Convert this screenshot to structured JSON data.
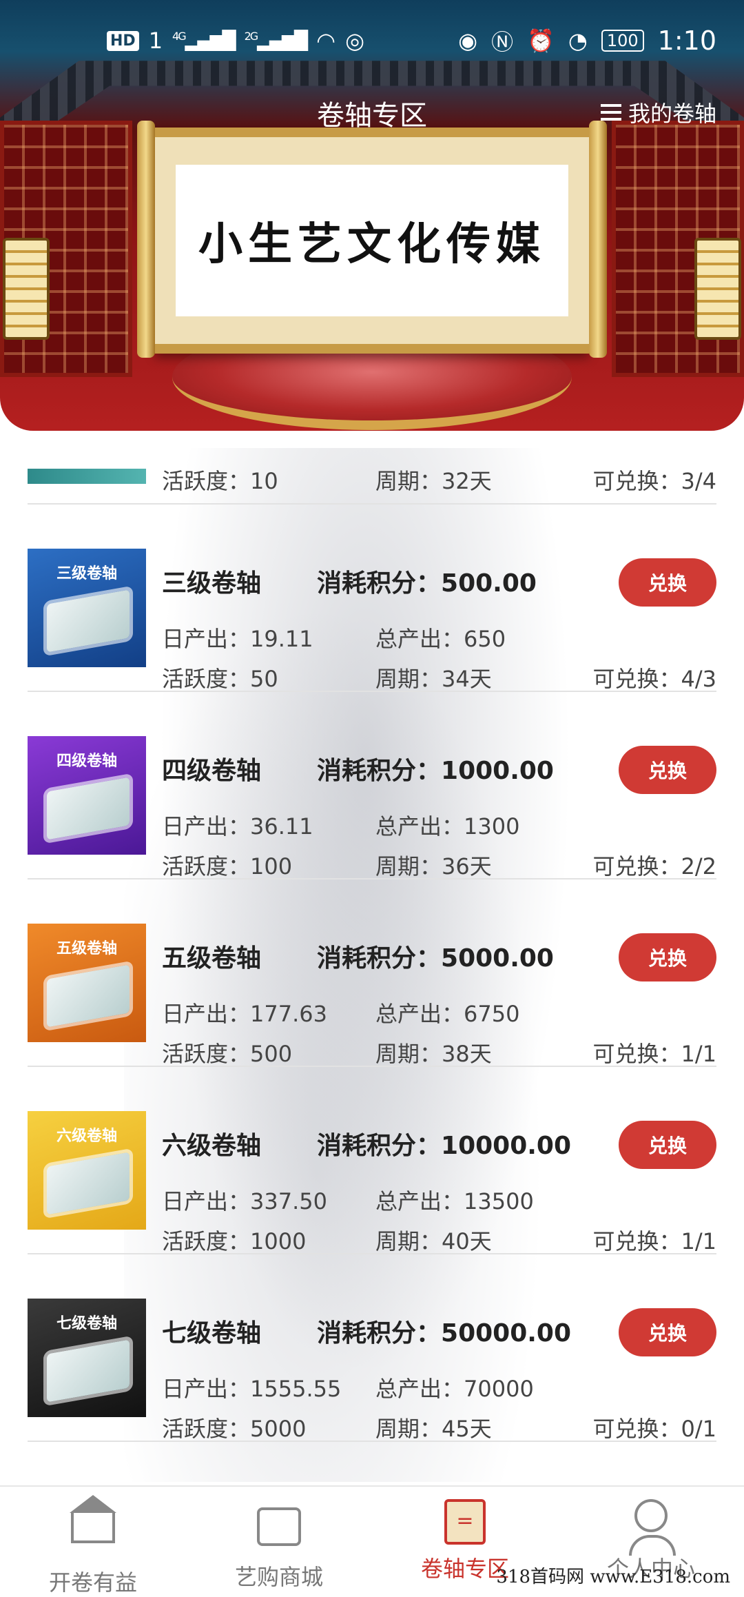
{
  "status_bar": {
    "hd_label": "HD",
    "sim_label": "1",
    "net1": "4G",
    "net2": "2G",
    "battery": "100",
    "time": "1:10"
  },
  "header": {
    "title": "卷轴专区",
    "my_scrolls_label": "我的卷轴",
    "banner_text": "小生艺文化传媒"
  },
  "labels": {
    "cost": "消耗积分：",
    "daily_output": "日产出：",
    "total_output": "总产出：",
    "activity": "活跃度：",
    "period": "周期：",
    "exchangeable": "可兑换：",
    "button": "兑换"
  },
  "partial_item": {
    "activity": "10",
    "period": "32天",
    "exchangeable": "3/4"
  },
  "items": [
    {
      "badge": "三级卷轴",
      "name": "三级卷轴",
      "cost": "500.00",
      "daily": "19.11",
      "total": "650",
      "activity": "50",
      "period": "34天",
      "exchangeable": "4/3",
      "color_top": "#2d6fc4",
      "color_bottom": "#123f86"
    },
    {
      "badge": "四级卷轴",
      "name": "四级卷轴",
      "cost": "1000.00",
      "daily": "36.11",
      "total": "1300",
      "activity": "100",
      "period": "36天",
      "exchangeable": "2/2",
      "color_top": "#8a3ad6",
      "color_bottom": "#4b1896"
    },
    {
      "badge": "五级卷轴",
      "name": "五级卷轴",
      "cost": "5000.00",
      "daily": "177.63",
      "total": "6750",
      "activity": "500",
      "period": "38天",
      "exchangeable": "1/1",
      "color_top": "#f08a2a",
      "color_bottom": "#c95a10"
    },
    {
      "badge": "六级卷轴",
      "name": "六级卷轴",
      "cost": "10000.00",
      "daily": "337.50",
      "total": "13500",
      "activity": "1000",
      "period": "40天",
      "exchangeable": "1/1",
      "color_top": "#f6d040",
      "color_bottom": "#e4a818"
    },
    {
      "badge": "七级卷轴",
      "name": "七级卷轴",
      "cost": "50000.00",
      "daily": "1555.55",
      "total": "70000",
      "activity": "5000",
      "period": "45天",
      "exchangeable": "0/1",
      "color_top": "#3a3a3a",
      "color_bottom": "#111111"
    }
  ],
  "bottom_nav": [
    {
      "label": "开卷有益",
      "icon": "home-icon",
      "active": false
    },
    {
      "label": "艺购商城",
      "icon": "shop-icon",
      "active": false
    },
    {
      "label": "卷轴专区",
      "icon": "scroll-icon",
      "active": true
    },
    {
      "label": "个人中心",
      "icon": "user-icon",
      "active": false
    }
  ],
  "watermark": "318首码网 www.E318.com",
  "colors": {
    "accent": "#d03a34",
    "active_nav": "#c9332c"
  }
}
